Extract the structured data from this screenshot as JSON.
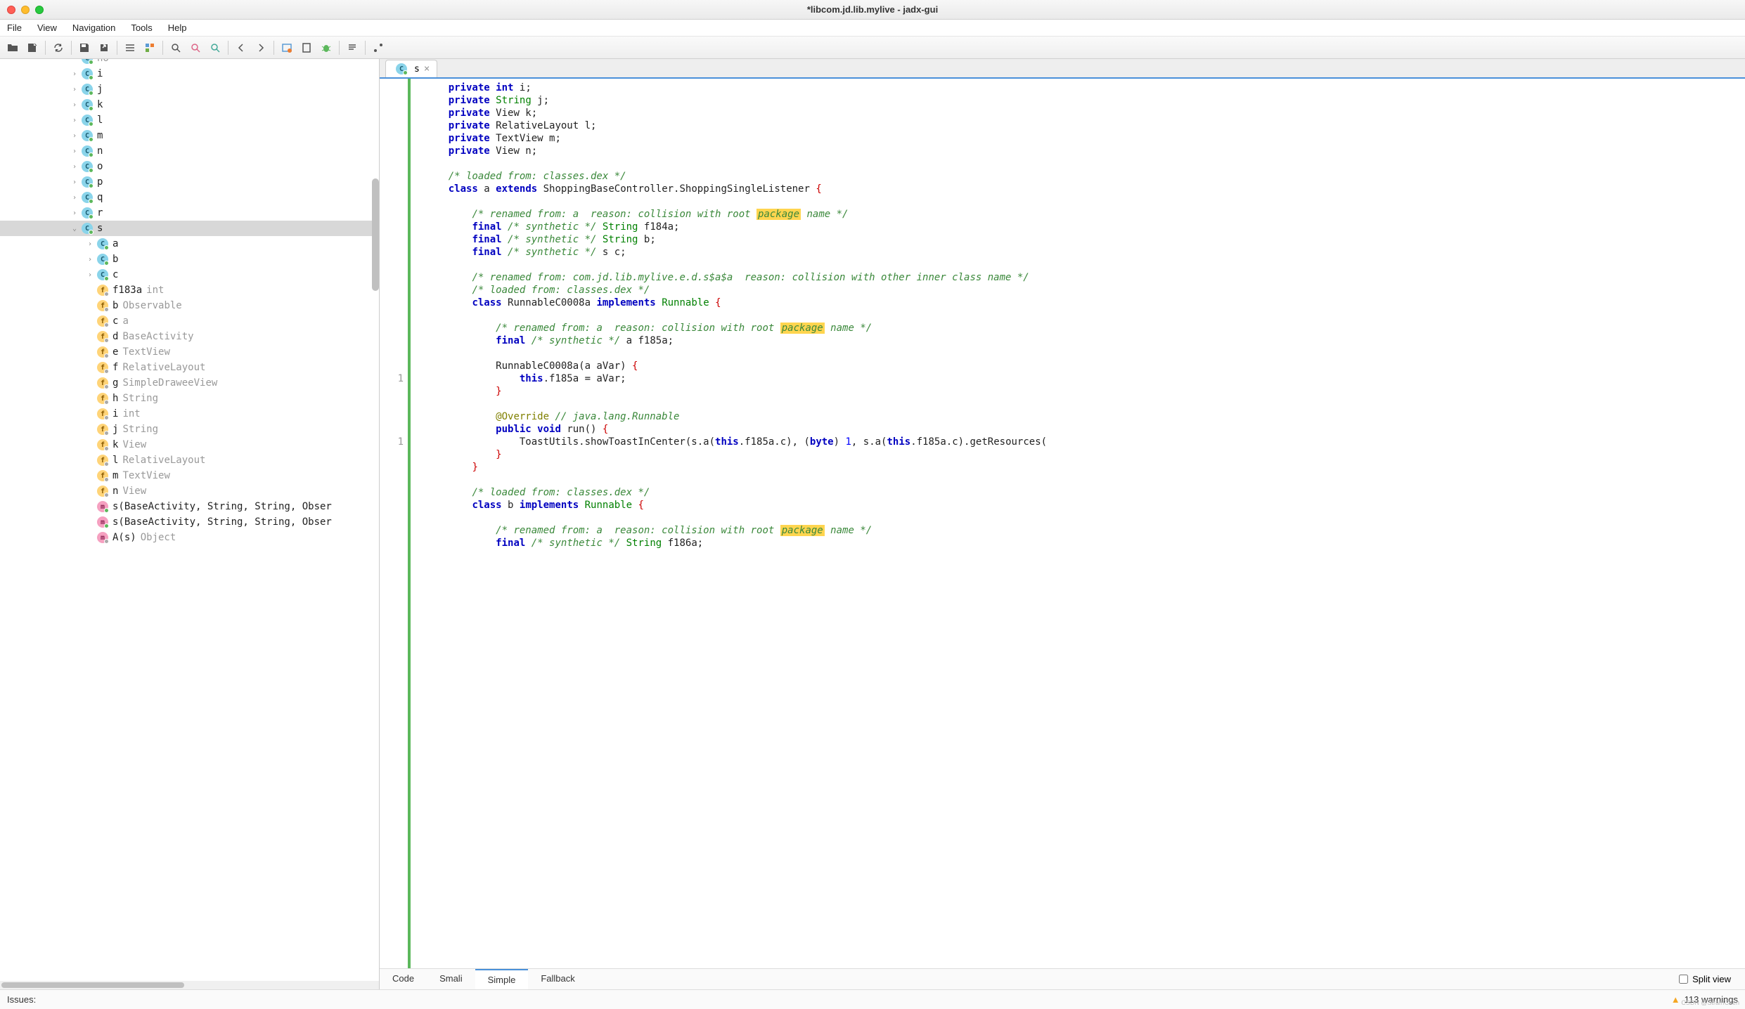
{
  "window": {
    "title": "*libcom.jd.lib.mylive - jadx-gui"
  },
  "menu": {
    "file": "File",
    "edit": "View",
    "nav": "Navigation",
    "tools": "Tools",
    "help": "Help"
  },
  "tree_visible_letter": "no",
  "tree": {
    "top_classes": [
      "i",
      "j",
      "k",
      "l",
      "m",
      "n",
      "o",
      "p",
      "q",
      "r"
    ],
    "selected": "s",
    "sub_classes": [
      "a",
      "b",
      "c"
    ],
    "fields": [
      {
        "n": "f183a",
        "t": "int"
      },
      {
        "n": "b",
        "t": "Observable"
      },
      {
        "n": "c",
        "t": "a"
      },
      {
        "n": "d",
        "t": "BaseActivity"
      },
      {
        "n": "e",
        "t": "TextView"
      },
      {
        "n": "f",
        "t": "RelativeLayout"
      },
      {
        "n": "g",
        "t": "SimpleDraweeView"
      },
      {
        "n": "h",
        "t": "String"
      },
      {
        "n": "i",
        "t": "int"
      },
      {
        "n": "j",
        "t": "String"
      },
      {
        "n": "k",
        "t": "View"
      },
      {
        "n": "l",
        "t": "RelativeLayout"
      },
      {
        "n": "m",
        "t": "TextView"
      },
      {
        "n": "n",
        "t": "View"
      }
    ],
    "methods": [
      "s(BaseActivity, String, String, Obser",
      "s(BaseActivity, String, String, Obser"
    ],
    "last_method": {
      "n": "A(s)",
      "t": "Object"
    }
  },
  "tab": {
    "name": "s"
  },
  "viewtabs": {
    "code": "Code",
    "smali": "Smali",
    "simple": "Simple",
    "fallback": "Fallback",
    "split": "Split view"
  },
  "status": {
    "issues": "Issues:",
    "warnings": "113 warnings"
  },
  "gutter": {
    "l1": "1",
    "l2": "1"
  },
  "code": {
    "f_i": "private int i;",
    "f_j_a": "private",
    "f_j_b": "String",
    "f_j_c": " j;",
    "f_k": "private View k;",
    "f_l": "private RelativeLayout l;",
    "f_m": "private TextView m;",
    "f_n": "private View n;",
    "c_load": "/* loaded from: classes.dex */",
    "cls_a_1": "class",
    "cls_a_name": " a ",
    "cls_a_ext": "extends",
    "cls_a_rest": " ShoppingBaseController.ShoppingSingleListener ",
    "brace_open": "{",
    "ren_a": "/* renamed from: a  reason: collision with root ",
    "pkg": "package",
    "ren_a_end": " name */",
    "f184_1": "final ",
    "f184_syn": "/* synthetic */",
    "sp": " ",
    "str_t": "String",
    "f184_3": " f184a;",
    "f_b_end": " b;",
    "f_c_1": "final ",
    "f_c_3": " s c;",
    "ren_inner": "/* renamed from: com.jd.lib.mylive.e.d.s$a$a  reason: collision with other inner class name */",
    "runA_1": "class",
    "runA_2": " RunnableC0008a ",
    "runA_3": "implements",
    "runA_4": " Runnable ",
    "brace_open2": "{",
    "f185": " a f185a;",
    "ctor": "RunnableC0008a(a aVar) ",
    "this_assign_a": "this",
    ".f185a": ".f185a = aVar;",
    "brace_close": "}",
    "ann_over": "@Override",
    "ann_cmt": " // java.lang.Runnable",
    "run_1": "public ",
    "run_void": "void",
    "run_2": " run() ",
    "toast_a": "    ToastUtils.showToastInCenter(s.a(",
    "this_kw": "this",
    "toast_b": ".f185a.c), (",
    "byte_kw": "byte",
    "toast_c": ") ",
    "one": "1",
    "toast_d": ", s.a(",
    "toast_e": ".f185a.c).getResources(",
    "cls_b_1": "class",
    "cls_b_2": " b ",
    "cls_b_3": "implements",
    "cls_b_4": " Runnable ",
    "f186_end": " f186a;"
  },
  "watermark": "CSDN @StramChen"
}
